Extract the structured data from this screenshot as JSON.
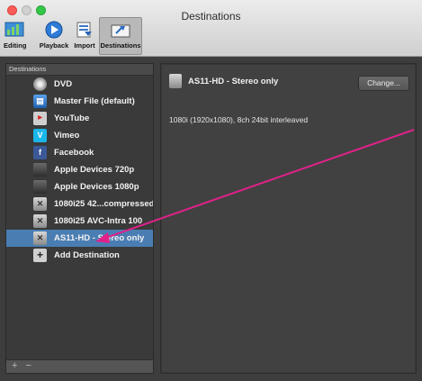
{
  "window": {
    "title": "Destinations"
  },
  "toolbar": {
    "items": [
      {
        "label": "Editing",
        "icon": "editing-icon"
      },
      {
        "label": "Playback",
        "icon": "playback-icon"
      },
      {
        "label": "Import",
        "icon": "import-icon"
      },
      {
        "label": "Destinations",
        "icon": "destinations-icon",
        "selected": true
      }
    ]
  },
  "sidebar": {
    "header": "Destinations",
    "items": [
      {
        "label": "DVD",
        "icon": "dvd-icon"
      },
      {
        "label": "Master File (default)",
        "icon": "master-file-icon"
      },
      {
        "label": "YouTube",
        "icon": "youtube-icon"
      },
      {
        "label": "Vimeo",
        "icon": "vimeo-icon"
      },
      {
        "label": "Facebook",
        "icon": "facebook-icon"
      },
      {
        "label": "Apple Devices 720p",
        "icon": "apple-devices-icon"
      },
      {
        "label": "Apple Devices 1080p",
        "icon": "apple-devices-icon"
      },
      {
        "label": "1080i25 42...compressed",
        "icon": "film-icon"
      },
      {
        "label": "1080i25 AVC-Intra 100",
        "icon": "film-icon"
      },
      {
        "label": "AS11-HD - Stereo only",
        "icon": "film-icon",
        "selected": true
      },
      {
        "label": "Add Destination",
        "icon": "add-icon"
      }
    ],
    "footer": {
      "add": "+",
      "remove": "−"
    }
  },
  "detail": {
    "title": "AS11-HD - Stereo only",
    "change_label": "Change...",
    "description": "1080i (1920x1080), 8ch 24bit interleaved"
  },
  "colors": {
    "annotation_arrow": "#e0218a",
    "selection": "#4a7eb3"
  }
}
